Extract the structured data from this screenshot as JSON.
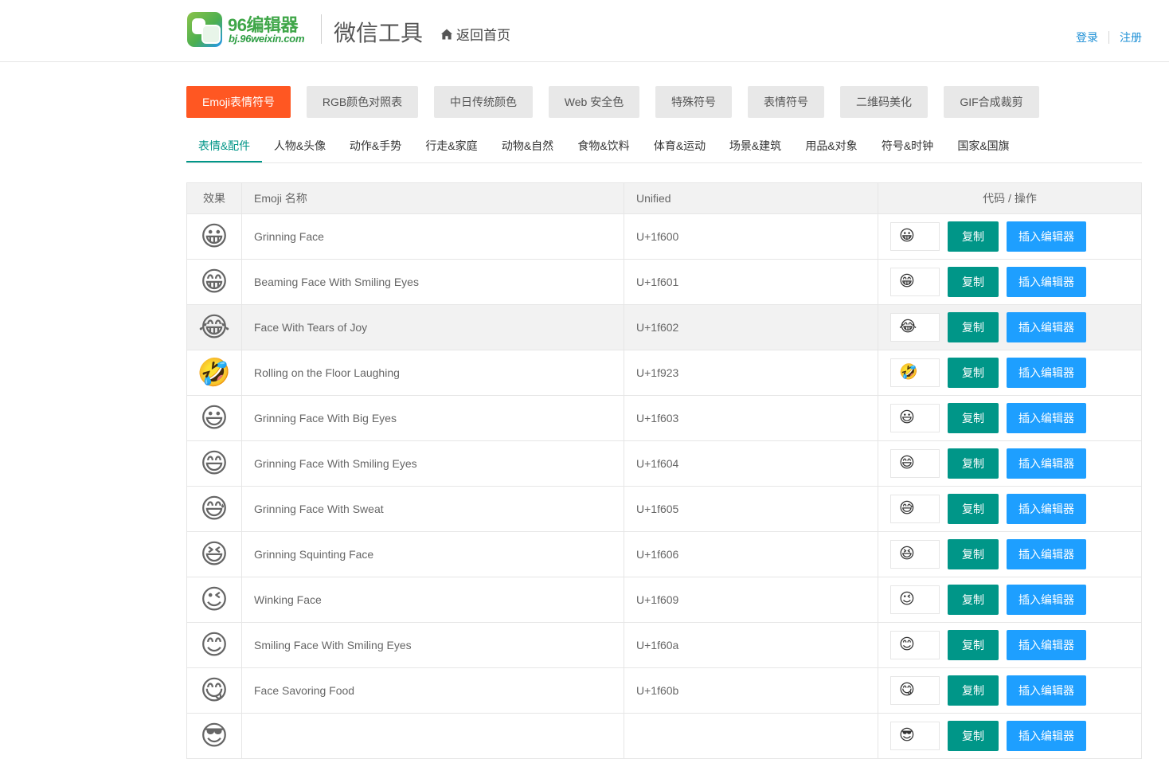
{
  "header": {
    "logo_title": "96编辑器",
    "logo_url": "bj.96weixin.com",
    "site_title": "微信工具",
    "home_label": "返回首页",
    "login": "登录",
    "register": "注册"
  },
  "tool_tabs": [
    {
      "label": "Emoji表情符号",
      "active": true
    },
    {
      "label": "RGB颜色对照表",
      "active": false
    },
    {
      "label": "中日传统颜色",
      "active": false
    },
    {
      "label": "Web 安全色",
      "active": false
    },
    {
      "label": "特殊符号",
      "active": false
    },
    {
      "label": "表情符号",
      "active": false
    },
    {
      "label": "二维码美化",
      "active": false
    },
    {
      "label": "GIF合成裁剪",
      "active": false
    }
  ],
  "category_tabs": [
    {
      "label": "表情&配件",
      "active": true
    },
    {
      "label": "人物&头像",
      "active": false
    },
    {
      "label": "动作&手势",
      "active": false
    },
    {
      "label": "行走&家庭",
      "active": false
    },
    {
      "label": "动物&自然",
      "active": false
    },
    {
      "label": "食物&饮料",
      "active": false
    },
    {
      "label": "体育&运动",
      "active": false
    },
    {
      "label": "场景&建筑",
      "active": false
    },
    {
      "label": "用品&对象",
      "active": false
    },
    {
      "label": "符号&时钟",
      "active": false
    },
    {
      "label": "国家&国旗",
      "active": false
    }
  ],
  "table": {
    "headers": {
      "effect": "效果",
      "name": "Emoji 名称",
      "unified": "Unified",
      "ops": "代码 / 操作"
    },
    "copy_label": "复制",
    "insert_label": "插入编辑器",
    "rows": [
      {
        "emoji": "😀",
        "name": "Grinning Face",
        "unified": "U+1f600"
      },
      {
        "emoji": "😁",
        "name": "Beaming Face With Smiling Eyes",
        "unified": "U+1f601"
      },
      {
        "emoji": "😂",
        "name": "Face With Tears of Joy",
        "unified": "U+1f602"
      },
      {
        "emoji": "🤣",
        "name": "Rolling on the Floor Laughing",
        "unified": "U+1f923"
      },
      {
        "emoji": "😃",
        "name": "Grinning Face With Big Eyes",
        "unified": "U+1f603"
      },
      {
        "emoji": "😄",
        "name": "Grinning Face With Smiling Eyes",
        "unified": "U+1f604"
      },
      {
        "emoji": "😅",
        "name": "Grinning Face With Sweat",
        "unified": "U+1f605"
      },
      {
        "emoji": "😆",
        "name": "Grinning Squinting Face",
        "unified": "U+1f606"
      },
      {
        "emoji": "😉",
        "name": "Winking Face",
        "unified": "U+1f609"
      },
      {
        "emoji": "😊",
        "name": "Smiling Face With Smiling Eyes",
        "unified": "U+1f60a"
      },
      {
        "emoji": "😋",
        "name": "Face Savoring Food",
        "unified": "U+1f60b"
      },
      {
        "emoji": "😎",
        "name": "",
        "unified": ""
      }
    ]
  },
  "highlighted_row": 2,
  "colors": {
    "active_tool_tab": "#ff5722",
    "active_category": "#009688",
    "copy_button": "#009688",
    "insert_button": "#1e9fff",
    "auth_link": "#1e90d6"
  }
}
